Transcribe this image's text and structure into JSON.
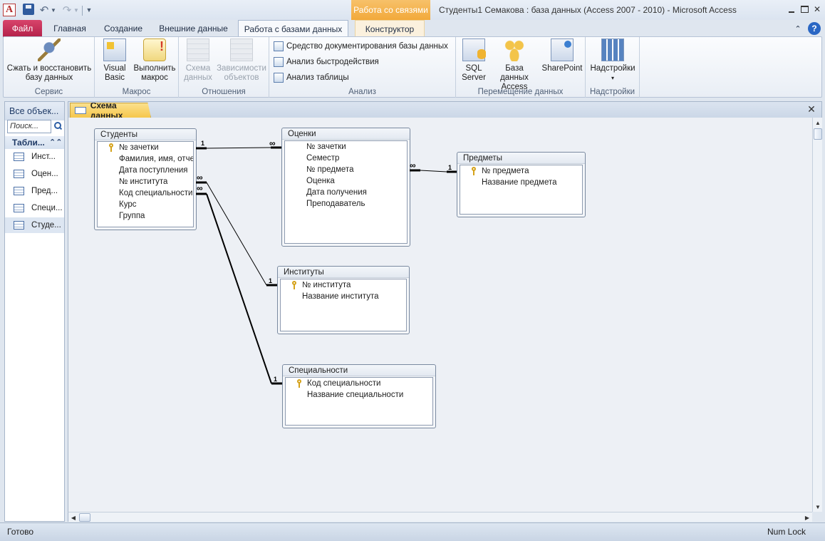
{
  "titlebar": {
    "app_icon_letter": "A",
    "context_tab_header": "Работа со связями",
    "title": "Студенты1 Семакова : база данных (Access 2007 - 2010)  -  Microsoft Access"
  },
  "tabs": {
    "file": "Файл",
    "home": "Главная",
    "create": "Создание",
    "external": "Внешние данные",
    "dbtools": "Работа с базами данных",
    "constructor": "Конструктор",
    "active": "Работа с базами данных"
  },
  "ribbon": {
    "groups": {
      "service": "Сервис",
      "macro": "Макрос",
      "relations": "Отношения",
      "analysis": "Анализ",
      "move": "Перемещение данных",
      "addins": "Надстройки"
    },
    "compact": {
      "line1": "Сжать и восстановить",
      "line2": "базу данных"
    },
    "vb": {
      "line1": "Visual",
      "line2": "Basic"
    },
    "run_macro": {
      "line1": "Выполнить",
      "line2": "макрос"
    },
    "schema": {
      "line1": "Схема",
      "line2": "данных"
    },
    "deps": {
      "line1": "Зависимости",
      "line2": "объектов"
    },
    "documenter": "Средство документирования базы данных",
    "perf": "Анализ быстродействия",
    "table_analysis": "Анализ таблицы",
    "sql": {
      "line1": "SQL",
      "line2": "Server"
    },
    "access_db": {
      "line1": "База данных",
      "line2": "Access"
    },
    "sharepoint": "SharePoint",
    "addins": "Надстройки"
  },
  "nav": {
    "header": "Все объек...",
    "search_placeholder": "Поиск...",
    "group": "Табли...",
    "items": [
      {
        "label": "Инст...",
        "selected": false
      },
      {
        "label": "Оцен...",
        "selected": false
      },
      {
        "label": "Пред...",
        "selected": false
      },
      {
        "label": "Специ...",
        "selected": false
      },
      {
        "label": "Студе...",
        "selected": true
      }
    ]
  },
  "document": {
    "tab": "Схема данных"
  },
  "tables": {
    "students": {
      "title": "Студенты",
      "fields": [
        {
          "name": "№ зачетки",
          "key": true
        },
        {
          "name": "Фамилия, имя, отче",
          "key": false
        },
        {
          "name": "Дата поступления",
          "key": false
        },
        {
          "name": "№ института",
          "key": false
        },
        {
          "name": "Код специальности",
          "key": false
        },
        {
          "name": "Курс",
          "key": false
        },
        {
          "name": "Группа",
          "key": false
        }
      ]
    },
    "grades": {
      "title": "Оценки",
      "fields": [
        {
          "name": "№ зачетки",
          "key": false
        },
        {
          "name": "Семестр",
          "key": false
        },
        {
          "name": "№ предмета",
          "key": false
        },
        {
          "name": "Оценка",
          "key": false
        },
        {
          "name": "Дата получения",
          "key": false
        },
        {
          "name": "Преподаватель",
          "key": false
        }
      ]
    },
    "subjects": {
      "title": "Предметы",
      "fields": [
        {
          "name": "№ предмета",
          "key": true
        },
        {
          "name": "Название предмета",
          "key": false
        }
      ]
    },
    "institutes": {
      "title": "Институты",
      "fields": [
        {
          "name": "№ института",
          "key": true
        },
        {
          "name": "Название института",
          "key": false
        }
      ]
    },
    "specialties": {
      "title": "Специальности",
      "fields": [
        {
          "name": "Код специальности",
          "key": true
        },
        {
          "name": "Название специальности",
          "key": false
        }
      ]
    }
  },
  "relationships": [
    {
      "from": "Студенты.№ зачетки",
      "to": "Оценки.№ зачетки",
      "one": "1",
      "many": "∞"
    },
    {
      "from": "Предметы.№ предмета",
      "to": "Оценки.№ предмета",
      "one": "1",
      "many": "∞"
    },
    {
      "from": "Институты.№ института",
      "to": "Студенты.№ института",
      "one": "1",
      "many": "∞"
    },
    {
      "from": "Специальности.Код специальности",
      "to": "Студенты.Код специальности",
      "one": "1",
      "many": "∞"
    }
  ],
  "status": {
    "text": "Готово",
    "numlock": "Num Lock"
  }
}
